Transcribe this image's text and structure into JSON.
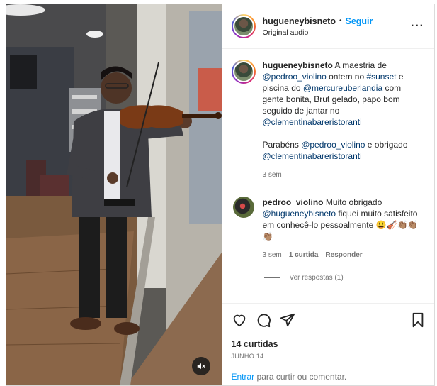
{
  "post": {
    "username": "hugueneybisneto",
    "separator": "•",
    "follow_label": "Seguir",
    "audio_label": "Original audio",
    "more_label": "···"
  },
  "caption": {
    "username": "hugueneybisneto",
    "segments": [
      {
        "t": "A maestria de ",
        "m": false
      },
      {
        "t": "@pedroo_violino",
        "m": true
      },
      {
        "t": " ontem no ",
        "m": false
      },
      {
        "t": "#sunset",
        "m": true
      },
      {
        "t": " e piscina do ",
        "m": false
      },
      {
        "t": "@mercureuberlandia",
        "m": true
      },
      {
        "t": " com gente bonita, Brut gelado, papo bom seguido de jantar no ",
        "m": false
      },
      {
        "t": "@clementinabareristoranti",
        "m": true
      }
    ],
    "segments2": [
      {
        "t": "Parabéns ",
        "m": false
      },
      {
        "t": "@pedroo_violino",
        "m": true
      },
      {
        "t": " e obrigado ",
        "m": false
      },
      {
        "t": "@clementinabareristoranti",
        "m": true
      }
    ],
    "time": "3 sem"
  },
  "comment": {
    "username": "pedroo_violino",
    "segments": [
      {
        "t": "Muito obrigado ",
        "m": false
      },
      {
        "t": "@hugueneybisneto",
        "m": true
      },
      {
        "t": " fiquei muito satisfeito em conhecê-lo pessoalmente 😃🎻👏🏽👏🏽👏🏽",
        "m": false
      }
    ],
    "time": "3 sem",
    "likes": "1 curtida",
    "reply": "Responder",
    "view_replies": "Ver respostas (1)"
  },
  "footer": {
    "likes": "14 curtidas",
    "date": "JUNHO 14",
    "enter": "Entrar",
    "add_text": " para curtir ou comentar."
  },
  "icons": {
    "like": "heart-icon",
    "comment": "comment-icon",
    "share": "share-icon",
    "save": "bookmark-icon",
    "mute": "muted-speaker-icon"
  }
}
